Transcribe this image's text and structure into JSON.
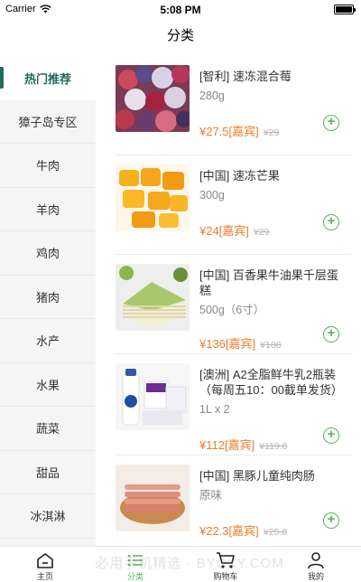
{
  "status_bar": {
    "carrier": "Carrier",
    "time": "5:08 PM"
  },
  "nav": {
    "title": "分类"
  },
  "sidebar": {
    "active_color": "#1f6b5c",
    "items": [
      {
        "label": "热门推荐",
        "active": true
      },
      {
        "label": "獐子岛专区",
        "active": false
      },
      {
        "label": "牛肉",
        "active": false
      },
      {
        "label": "羊肉",
        "active": false
      },
      {
        "label": "鸡肉",
        "active": false
      },
      {
        "label": "猪肉",
        "active": false
      },
      {
        "label": "水产",
        "active": false
      },
      {
        "label": "水果",
        "active": false
      },
      {
        "label": "蔬菜",
        "active": false
      },
      {
        "label": "甜品",
        "active": false
      },
      {
        "label": "冰淇淋",
        "active": false
      }
    ]
  },
  "products": [
    {
      "name": "[智利] 速冻混合莓",
      "spec": "280g",
      "price": "¥27.5[嘉宾]",
      "old_price": "¥29",
      "image": "mixed-berries"
    },
    {
      "name": "[中国] 速冻芒果",
      "spec": "300g",
      "price": "¥24[嘉宾]",
      "old_price": "¥29",
      "image": "mango"
    },
    {
      "name": "[中国] 百香果牛油果千层蛋糕",
      "spec": "500g（6寸）",
      "price": "¥136[嘉宾]",
      "old_price": "¥188",
      "image": "crepe-cake"
    },
    {
      "name": "[澳洲] A2全脂鲜牛乳2瓶装（每周五10：00截单发货）",
      "spec": "1L x 2",
      "price": "¥112[嘉宾]",
      "old_price": "¥119.8",
      "image": "milk"
    },
    {
      "name": "[中国] 黑豚儿童纯肉肠",
      "spec": "原味",
      "price": "¥22.3[嘉宾]",
      "old_price": "¥25.8",
      "image": "sausage"
    }
  ],
  "tab_bar": {
    "active_color": "#5db25d",
    "tabs": [
      {
        "label": "主页",
        "icon": "home-icon",
        "active": false
      },
      {
        "label": "分类",
        "icon": "list-icon",
        "active": true
      },
      {
        "label": "购物车",
        "icon": "cart-icon",
        "active": false
      },
      {
        "label": "我的",
        "icon": "profile-icon",
        "active": false
      }
    ]
  },
  "watermark": "必用手机精选 · BYCKY.COM"
}
